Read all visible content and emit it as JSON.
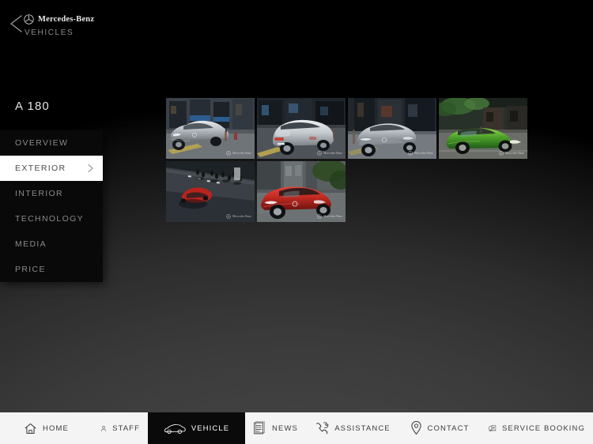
{
  "header": {
    "back_icon": "chevron-left-icon",
    "brand_star_icon": "mercedes-star-icon",
    "brand_name": "Mercedes-Benz",
    "section_label": "VEHICLES"
  },
  "model": {
    "title": "A 180"
  },
  "sidebar": {
    "items": [
      {
        "label": "OVERVIEW",
        "active": false
      },
      {
        "label": "EXTERIOR",
        "active": true
      },
      {
        "label": "INTERIOR",
        "active": false
      },
      {
        "label": "TECHNOLOGY",
        "active": false
      },
      {
        "label": "MEDIA",
        "active": false
      },
      {
        "label": "PRICE",
        "active": false
      }
    ],
    "active_chevron_icon": "chevron-right-icon"
  },
  "gallery": {
    "watermark_text": "Mercedes-Benz",
    "watermark_star_icon": "mercedes-star-icon",
    "thumbnails": [
      {
        "alt": "Silver A-Class front three-quarter on city street with blue awnings"
      },
      {
        "alt": "Silver A-Class rear three-quarter on urban corner"
      },
      {
        "alt": "Silver A-Class front view parked by storefront"
      },
      {
        "alt": "Green A-Class side profile under canopy"
      },
      {
        "alt": "Red A-Class overhead view on crosswalk with pedestrians"
      },
      {
        "alt": "Red A-Class front three-quarter on sunlit street"
      }
    ]
  },
  "bottom_nav": {
    "items": [
      {
        "label": "HOME",
        "icon": "home-icon",
        "active": false
      },
      {
        "label": "STAFF",
        "icon": "person-icon",
        "active": false
      },
      {
        "label": "VEHICLE",
        "icon": "car-icon",
        "active": true
      },
      {
        "label": "NEWS",
        "icon": "newspaper-icon",
        "active": false
      },
      {
        "label": "ASSISTANCE",
        "icon": "phone-wrench-icon",
        "active": false
      },
      {
        "label": "CONTACT",
        "icon": "map-pin-icon",
        "active": false
      },
      {
        "label": "SERVICE BOOKING",
        "icon": "truck-document-icon",
        "active": false
      }
    ]
  },
  "colors": {
    "background_dark": "#3d3d3d",
    "sidebar_bg": "#090909",
    "sidebar_active_bg": "#ffffff",
    "navbar_bg": "#f4f4f4",
    "nav_active_bg": "#0a0a0a",
    "muted_text": "#8a8a8a"
  }
}
